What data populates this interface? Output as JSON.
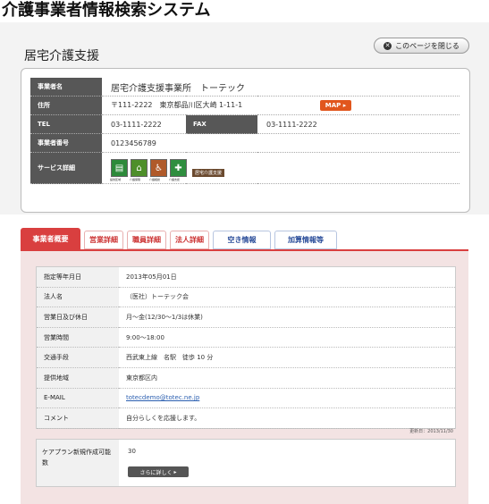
{
  "header": {
    "system_title": "介護事業者情報検索システム"
  },
  "page": {
    "title": "居宅介護支援",
    "close_label": "このページを閉じる"
  },
  "info": {
    "name_label": "事業者名",
    "name": "居宅介護支援事業所　トーテック",
    "address_label": "住所",
    "address": "〒111-2222　東京都品川区大崎 1-11-1",
    "map_label": "MAP",
    "tel_label": "TEL",
    "tel": "03-1111-2222",
    "fax_label": "FAX",
    "fax": "03-1111-2222",
    "number_label": "事業者番号",
    "number": "0123456789",
    "service_label": "サービス詳細",
    "services": [
      "提供区域",
      "介護保険",
      "介護相談",
      "介護支援"
    ],
    "service_tag": "居宅介護支援",
    "service_colors": [
      "#2d8a3a",
      "#4e8f2a",
      "#b05a2a",
      "#2f8e3f"
    ]
  },
  "tabs": [
    "事業者概要",
    "営業詳細",
    "職員詳細",
    "法人詳細",
    "空き情報",
    "加算情報等"
  ],
  "details": [
    {
      "label": "指定等年月日",
      "value": "2013年05月01日"
    },
    {
      "label": "法人名",
      "value": "（医社）トーテック会"
    },
    {
      "label": "営業日及び休日",
      "value": "月～金(12/30～1/3は休業)"
    },
    {
      "label": "営業時間",
      "value": "9:00～18:00"
    },
    {
      "label": "交通手段",
      "value": "西武東上線　名駅　徒歩 10 分"
    },
    {
      "label": "提供地域",
      "value": "東京都区内"
    },
    {
      "label": "E-MAIL",
      "value": "totecdemo@totec.ne.jp"
    },
    {
      "label": "コメント",
      "value": "自分らしくを応援します。"
    }
  ],
  "updated": "更新日：2013/11/30",
  "plan": {
    "label": "ケアプラン新規作成可能数",
    "value": "30",
    "more_label": "さらに詳しく"
  }
}
